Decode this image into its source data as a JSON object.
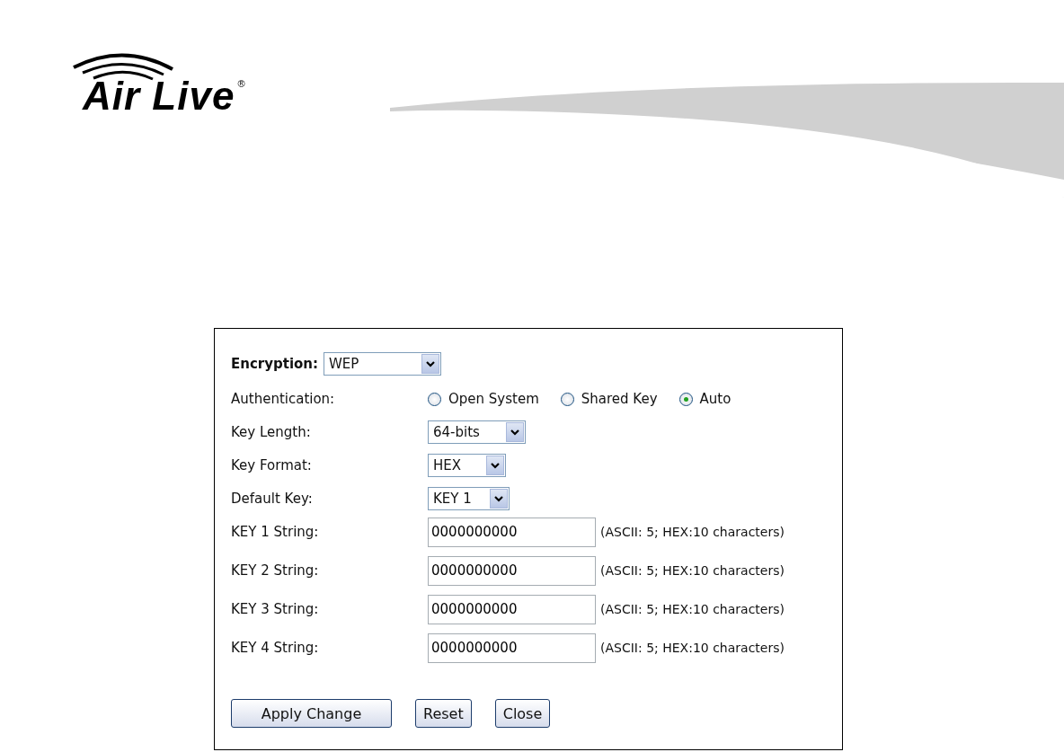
{
  "logo": {
    "text": "Air Live",
    "mark": "®"
  },
  "encryption": {
    "label": "Encryption:",
    "value": "WEP"
  },
  "authentication": {
    "label": "Authentication:",
    "options": [
      {
        "label": "Open System",
        "selected": false
      },
      {
        "label": "Shared Key",
        "selected": false
      },
      {
        "label": "Auto",
        "selected": true
      }
    ]
  },
  "selects": [
    {
      "label": "Key Length:",
      "value": "64-bits"
    },
    {
      "label": "Key Format:",
      "value": "HEX"
    },
    {
      "label": "Default Key:",
      "value": "KEY 1"
    }
  ],
  "keys": [
    {
      "label": "KEY 1 String:",
      "value": "0000000000",
      "hint": "(ASCII: 5; HEX:10 characters)"
    },
    {
      "label": "KEY 2 String:",
      "value": "0000000000",
      "hint": "(ASCII: 5; HEX:10 characters)"
    },
    {
      "label": "KEY 3 String:",
      "value": "0000000000",
      "hint": "(ASCII: 5; HEX:10 characters)"
    },
    {
      "label": "KEY 4 String:",
      "value": "0000000000",
      "hint": "(ASCII: 5; HEX:10 characters)"
    }
  ],
  "buttons": [
    {
      "label": "Apply Change",
      "kind": "wide"
    },
    {
      "label": "Reset",
      "kind": "normal"
    },
    {
      "label": "Close",
      "kind": "normal"
    }
  ]
}
